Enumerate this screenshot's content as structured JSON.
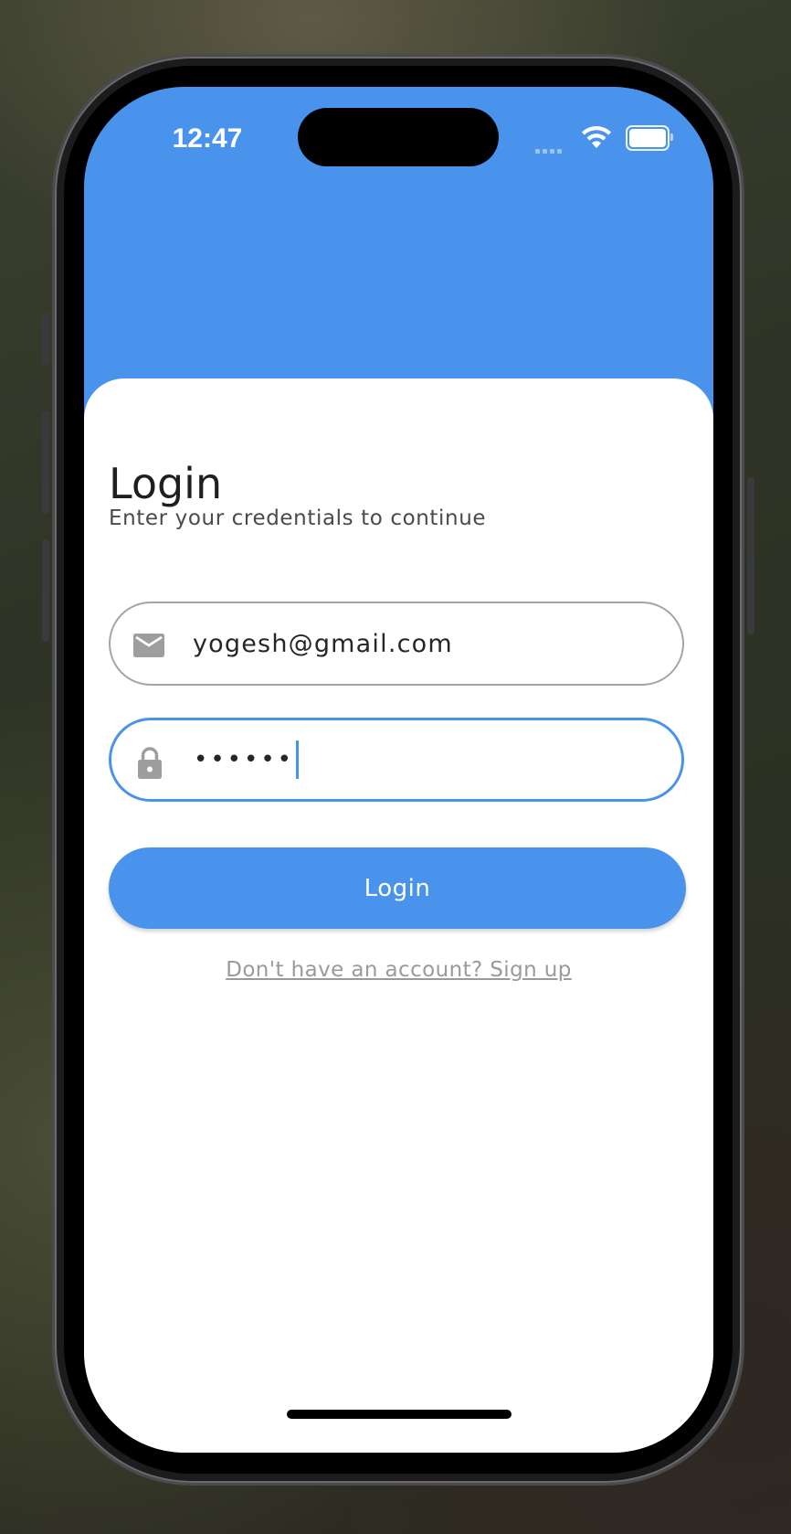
{
  "status_bar": {
    "time": "12:47",
    "signal_icon": "cellular-signal-icon",
    "wifi_icon": "wifi-icon",
    "battery_icon": "battery-icon"
  },
  "login": {
    "title": "Login",
    "subtitle": "Enter your credentials to continue",
    "email_field": {
      "icon": "mail-icon",
      "value": "yogesh@gmail.com"
    },
    "password_field": {
      "icon": "lock-icon",
      "masked_value": "••••••",
      "focused": true
    },
    "login_button_label": "Login",
    "signup_link": "Don't have an account? Sign up"
  },
  "colors": {
    "primary": "#4a93ec",
    "field_border": "#a5a5a5",
    "link": "#9a9a9a"
  }
}
